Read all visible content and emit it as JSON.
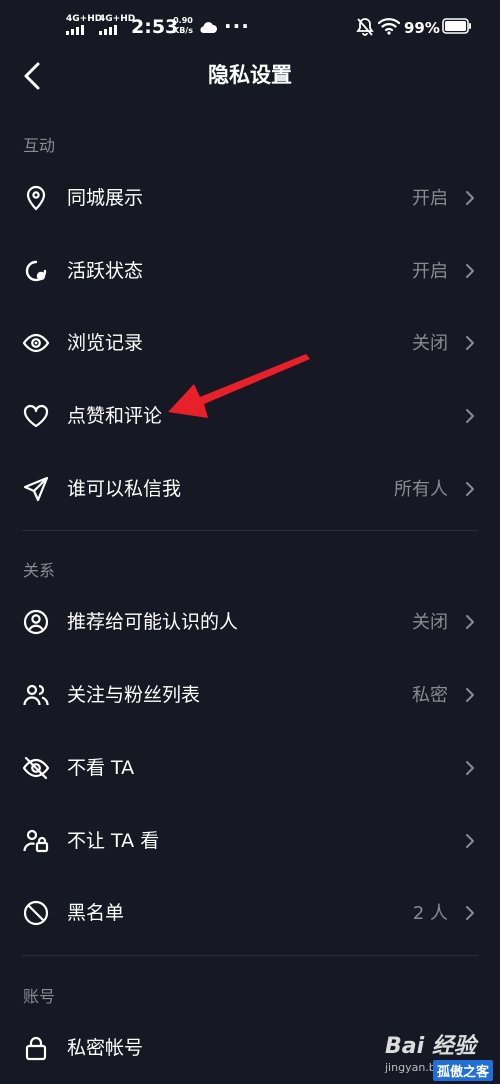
{
  "status_bar": {
    "network_1": "4G+HD",
    "network_2": "4G+HD",
    "time": "2:53",
    "speed_value": "0.90",
    "speed_unit": "KB/s",
    "overflow": "···",
    "battery": "99%"
  },
  "nav": {
    "title": "隐私设置"
  },
  "sections": {
    "interaction": {
      "header": "互动",
      "items": [
        {
          "label": "同城展示",
          "value": "开启",
          "icon": "location-pin-icon"
        },
        {
          "label": "活跃状态",
          "value": "开启",
          "icon": "activity-status-icon"
        },
        {
          "label": "浏览记录",
          "value": "关闭",
          "icon": "eye-icon"
        },
        {
          "label": "点赞和评论",
          "value": "",
          "icon": "heart-icon"
        },
        {
          "label": "谁可以私信我",
          "value": "所有人",
          "icon": "send-icon"
        }
      ]
    },
    "relationship": {
      "header": "关系",
      "items": [
        {
          "label": "推荐给可能认识的人",
          "value": "关闭",
          "icon": "user-circle-icon"
        },
        {
          "label": "关注与粉丝列表",
          "value": "私密",
          "icon": "users-icon"
        },
        {
          "label": "不看 TA",
          "value": "",
          "icon": "eye-off-icon"
        },
        {
          "label": "不让 TA 看",
          "value": "",
          "icon": "user-lock-icon"
        },
        {
          "label": "黑名单",
          "value": "2 人",
          "icon": "block-icon"
        }
      ]
    },
    "account": {
      "header": "账号",
      "items": [
        {
          "label": "私密帐号",
          "value": "",
          "icon": "lock-icon"
        }
      ]
    }
  },
  "watermark": {
    "baidu": "Bai 经验",
    "site": "jingyan.ba",
    "brand": "孤傲之客"
  },
  "colors": {
    "background": "#161823",
    "text_primary": "#ffffff",
    "text_secondary": "#8a8b91",
    "annotation_arrow": "#e8202a"
  }
}
